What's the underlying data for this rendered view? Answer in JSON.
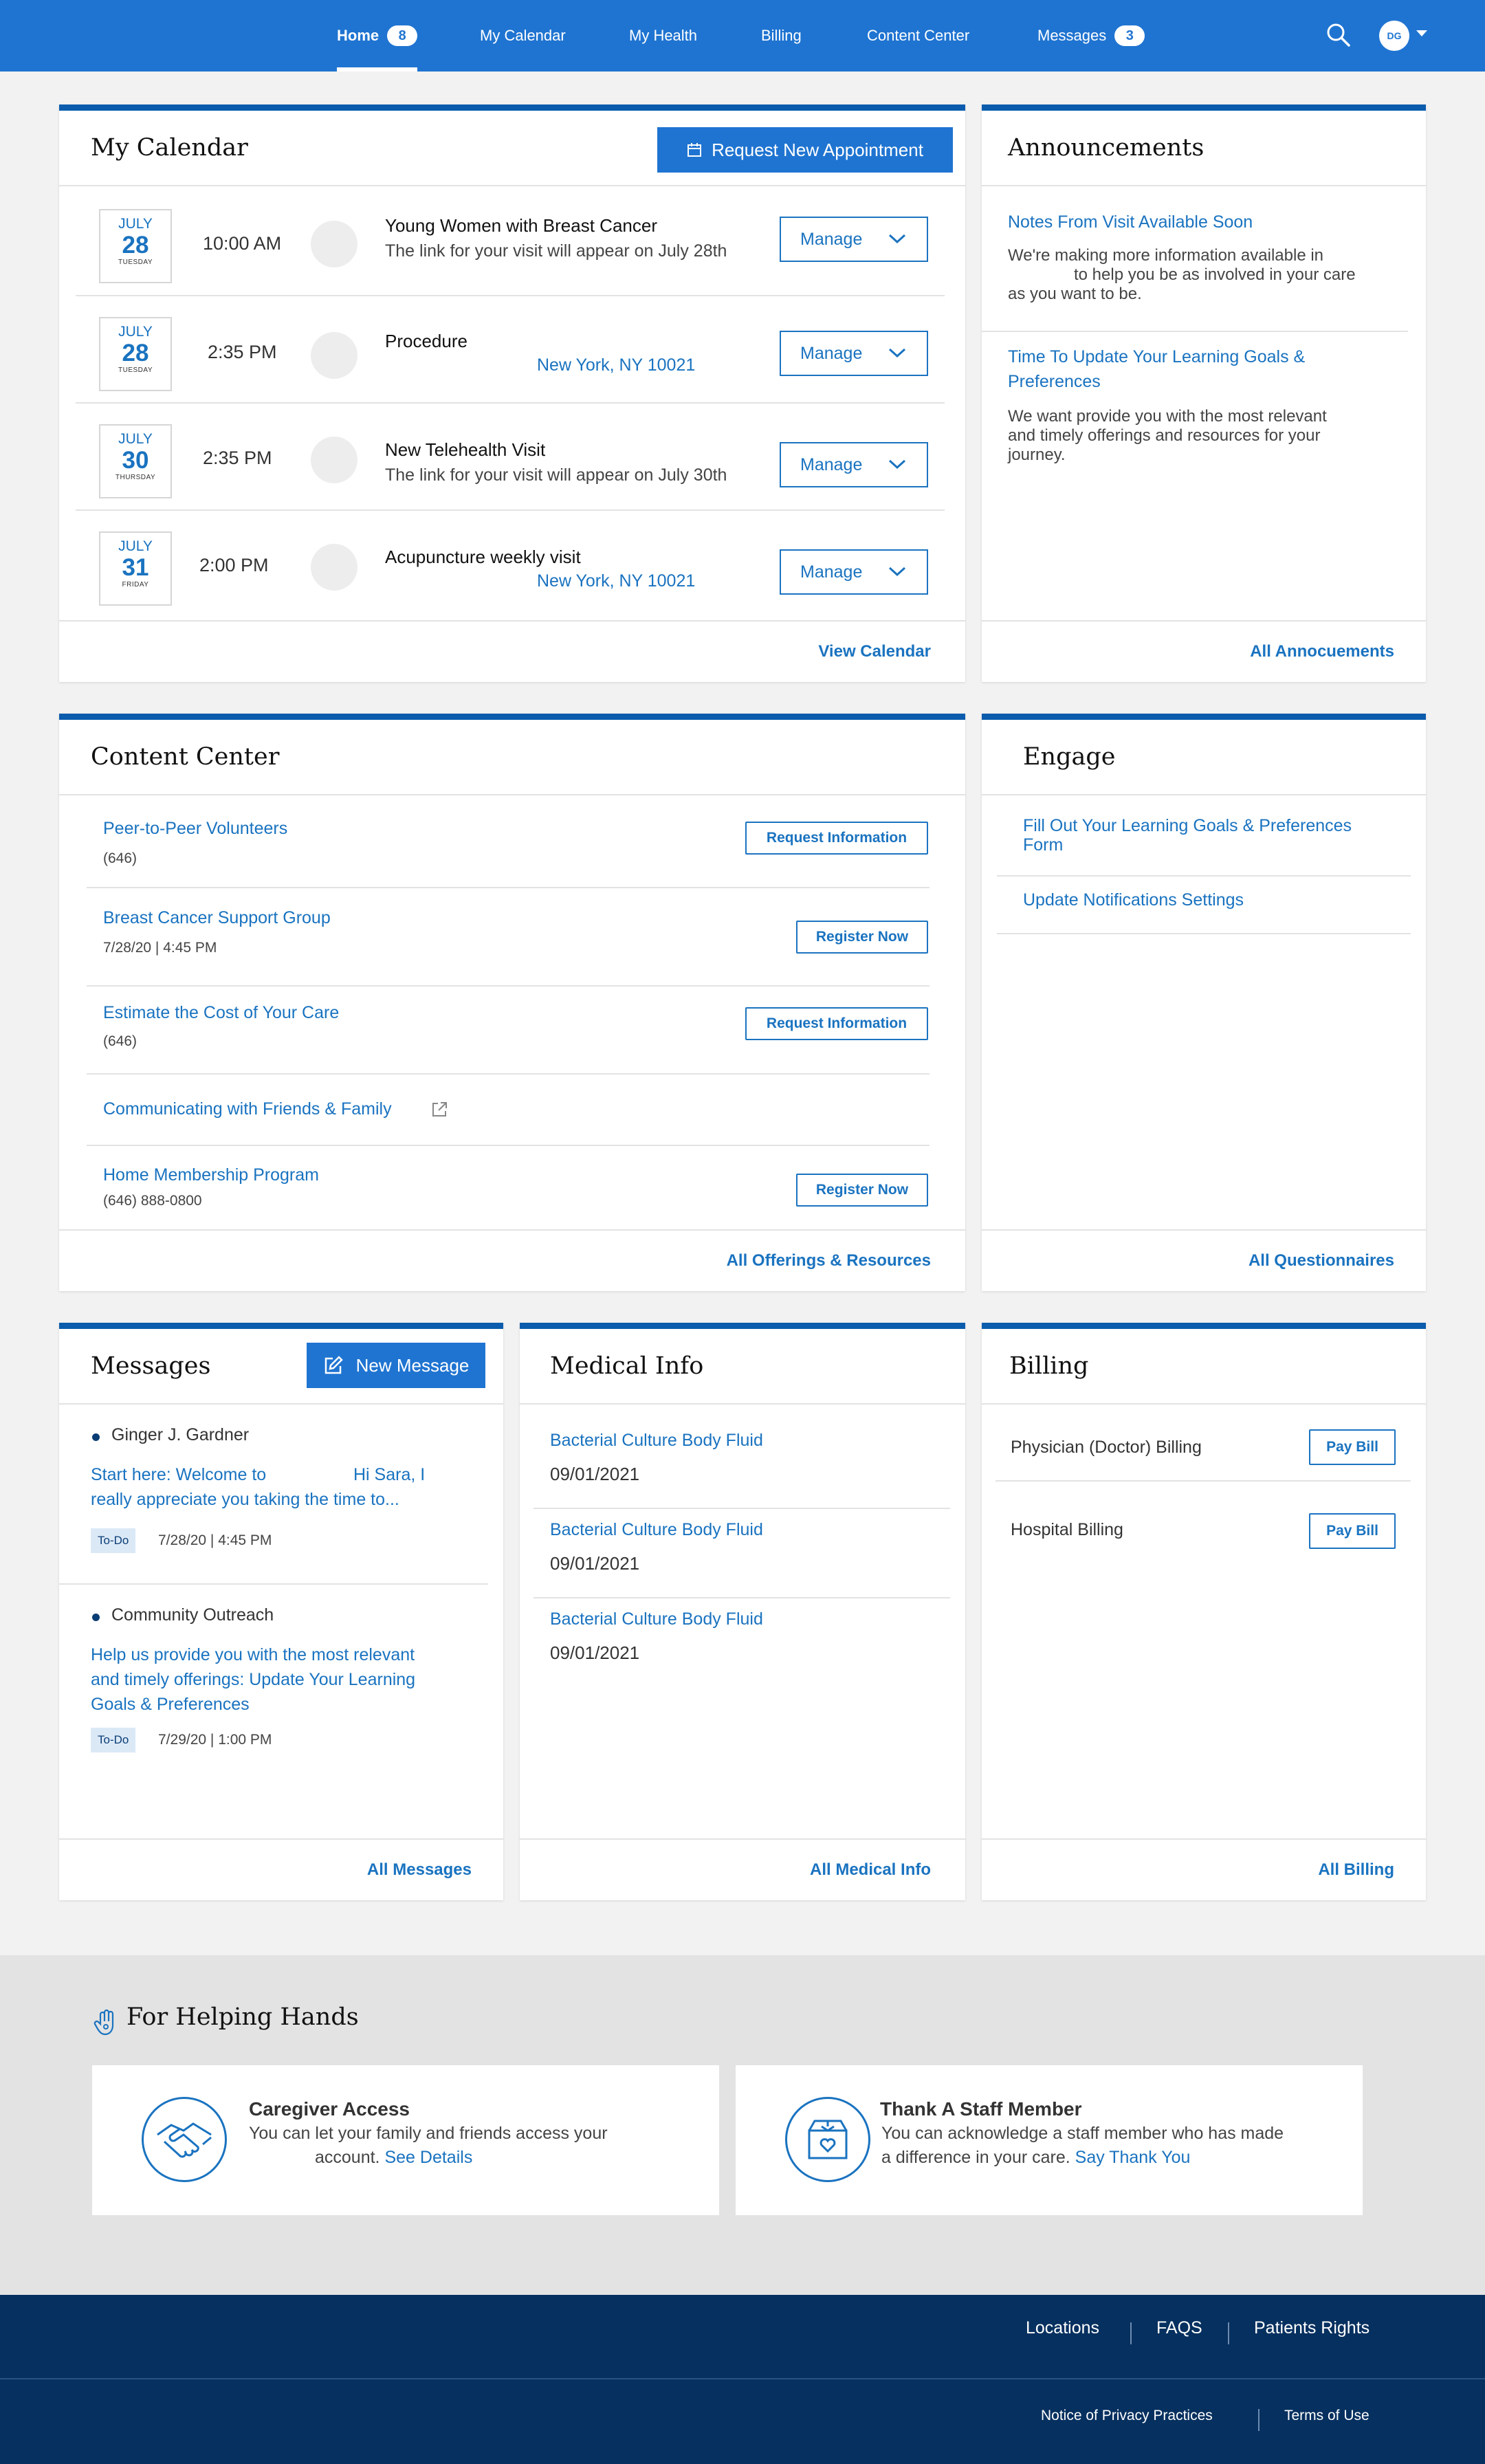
{
  "nav": {
    "home": "Home",
    "home_count": "8",
    "calendar": "My Calendar",
    "health": "My Health",
    "billing": "Billing",
    "content": "Content Center",
    "messages": "Messages",
    "messages_count": "3",
    "avatar_initials": "DG"
  },
  "calendar": {
    "title": "My Calendar",
    "request_btn": "Request New Appointment",
    "manage_label": "Manage",
    "footer_link": "View Calendar",
    "appointments": [
      {
        "month": "JULY",
        "day": "28",
        "weekday": "TUESDAY",
        "time": "10:00 AM",
        "title": "Young Women with Breast Cancer",
        "sub": "The link for your visit will appear on July 28th",
        "location": ""
      },
      {
        "month": "JULY",
        "day": "28",
        "weekday": "TUESDAY",
        "time": "2:35 PM",
        "title": "Procedure",
        "sub": "",
        "location": "New York, NY 10021"
      },
      {
        "month": "JULY",
        "day": "30",
        "weekday": "THURSDAY",
        "time": "2:35 PM",
        "title": "New Telehealth Visit",
        "sub": "The link for your visit will appear on July 30th",
        "location": ""
      },
      {
        "month": "JULY",
        "day": "31",
        "weekday": "FRIDAY",
        "time": "2:00 PM",
        "title": "Acupuncture weekly visit",
        "sub": "",
        "location": "New York, NY 10021"
      }
    ]
  },
  "announcements": {
    "title": "Announcements",
    "items": [
      {
        "link": "Notes From Visit Available Soon",
        "text1": "We're making more information available in",
        "text2": "to help you be as involved in your care",
        "text3": "as you want to be."
      },
      {
        "link1": "Time To Update Your Learning Goals &",
        "link2": "Preferences",
        "text1": "We want provide you with the most relevant",
        "text2": "and timely offerings and resources for your",
        "text3": "journey."
      }
    ],
    "footer_link": "All Annocuements"
  },
  "content_center": {
    "title": "Content Center",
    "items": [
      {
        "link": "Peer-to-Peer Volunteers",
        "sub": "(646)",
        "button": "Request Information"
      },
      {
        "link": "Breast Cancer Support Group",
        "sub": "7/28/20 | 4:45 PM",
        "button": "Register Now"
      },
      {
        "link": "Estimate the Cost of Your Care",
        "sub": "(646)",
        "button": "Request Information"
      },
      {
        "link": "Communicating with Friends & Family",
        "sub": "",
        "button": ""
      },
      {
        "link": "Home Membership Program",
        "sub": "(646) 888-0800",
        "button": "Register Now"
      }
    ],
    "footer_link": "All Offerings & Resources"
  },
  "engage": {
    "title": "Engage",
    "items": [
      {
        "line1": "Fill Out Your Learning Goals & Preferences",
        "line2": "Form"
      },
      {
        "line1": "Update Notifications Settings"
      }
    ],
    "footer_link": "All Questionnaires"
  },
  "messages": {
    "title": "Messages",
    "new_btn": "New Message",
    "items": [
      {
        "from": "Ginger J. Gardner",
        "line1a": "Start here: Welcome to",
        "line1b": "Hi Sara, I",
        "line2": "really appreciate you taking the time to...",
        "tag": "To-Do",
        "date": "7/28/20 | 4:45 PM"
      },
      {
        "from": "Community Outreach",
        "line1": "Help us provide you with the most relevant",
        "line2": "and timely offerings: Update Your Learning",
        "line3": "Goals & Preferences",
        "tag": "To-Do",
        "date": "7/29/20 | 1:00 PM"
      }
    ],
    "footer_link": "All Messages"
  },
  "medical": {
    "title": "Medical Info",
    "items": [
      {
        "name": "Bacterial Culture Body Fluid",
        "date": "09/01/2021"
      },
      {
        "name": "Bacterial Culture Body Fluid",
        "date": "09/01/2021"
      },
      {
        "name": "Bacterial Culture Body Fluid",
        "date": "09/01/2021"
      }
    ],
    "footer_link": "All Medical Info"
  },
  "billing": {
    "title": "Billing",
    "items": [
      {
        "label": "Physician (Doctor) Billing",
        "button": "Pay Bill"
      },
      {
        "label": "Hospital Billing",
        "button": "Pay Bill"
      }
    ],
    "footer_link": "All Billing"
  },
  "helping": {
    "title": "For Helping Hands",
    "cards": [
      {
        "title": "Caregiver Access",
        "line1": "You can let your family and friends access your",
        "line2": "account.",
        "link": "See Details"
      },
      {
        "title": "Thank A Staff Member",
        "line1": "You can acknowledge a staff member who has made",
        "line2": "a difference in your care.",
        "link": "Say Thank You"
      }
    ]
  },
  "footer": {
    "locations": "Locations",
    "faqs": "FAQS",
    "rights": "Patients Rights",
    "privacy": "Notice of Privacy Practices",
    "terms": "Terms of Use"
  },
  "colors": {
    "nav_blue": "#1f74d1",
    "card_accent": "#0b5cad",
    "link": "#1a73c0",
    "footer_navy": "#06305f"
  }
}
